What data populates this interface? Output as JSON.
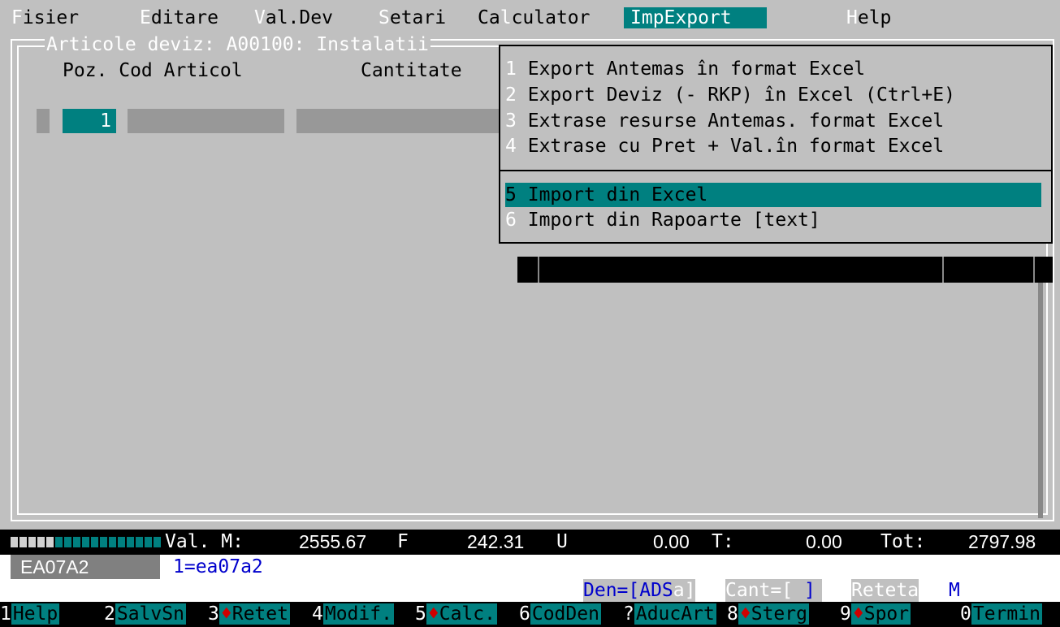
{
  "menubar": {
    "items": [
      {
        "hotkey": "F",
        "rest": "isier"
      },
      {
        "hotkey": "E",
        "rest": "ditare"
      },
      {
        "hotkey": "V",
        "rest": "al.Dev"
      },
      {
        "hotkey": "S",
        "rest": "etari"
      },
      {
        "hotkey": "Ca",
        "rest": "l",
        "tail": "culator"
      },
      {
        "label": "ImpExport"
      },
      {
        "hotkey": "H",
        "rest": "elp"
      }
    ]
  },
  "window": {
    "title": "Articole deviz: A00100: Instalatii",
    "headers": {
      "poz": "Poz. Cod Articol",
      "cant": "Cantitate"
    },
    "row": {
      "poz": "1"
    }
  },
  "dropdown": {
    "items": [
      {
        "num": "1",
        "label": "Export Antemas în format Excel"
      },
      {
        "num": "2",
        "label": "Export Deviz (- RKP) în  Excel (Ctrl+E)"
      },
      {
        "num": "3",
        "label": "Extrase resurse Antemas. format Excel"
      },
      {
        "num": "4",
        "label": "Extrase cu Pret + Val.în format Excel"
      },
      {
        "num": "5",
        "label": "Import din Excel"
      },
      {
        "num": "6",
        "label": "Import din Rapoarte [text]"
      }
    ],
    "selected_index": 4
  },
  "status": {
    "val_label": "Val. M:",
    "m_value": "2555.67",
    "f_label": "F",
    "f_value": "242.31",
    "u_label": "U",
    "u_value": "0.00",
    "t_label": "T:",
    "t_value": "0.00",
    "tot_label": "Tot:",
    "tot_value": "2797.98"
  },
  "codeline": {
    "code": "EA07A2",
    "value": "1=ea07a2"
  },
  "infoline": {
    "den": "Den=[ADS",
    "den_tail": "a]",
    "cant": "Cant=[",
    "cant_tail": "]",
    "reteta": "Reteta",
    "m": "M"
  },
  "fkeys": [
    {
      "key": "1",
      "label": "Help",
      "diamond": false
    },
    {
      "key": "2",
      "label": "SalvSn",
      "diamond": false
    },
    {
      "key": "3",
      "label": "Retet",
      "diamond": true
    },
    {
      "key": "4",
      "label": "Modif.",
      "diamond": false
    },
    {
      "key": "5",
      "label": "Calc.",
      "diamond": true
    },
    {
      "key": "6",
      "label": "CodDen",
      "diamond": false
    },
    {
      "key": "?",
      "label": "AducArt",
      "diamond": false
    },
    {
      "key": "8",
      "label": "Sterg",
      "diamond": true
    },
    {
      "key": "9",
      "label": "Spor",
      "diamond": true
    },
    {
      "key": "0",
      "label": "Termin",
      "diamond": false
    }
  ],
  "colors": {
    "accent": "#008080",
    "background": "#c0c0c0",
    "text_blue": "#0000cc"
  }
}
